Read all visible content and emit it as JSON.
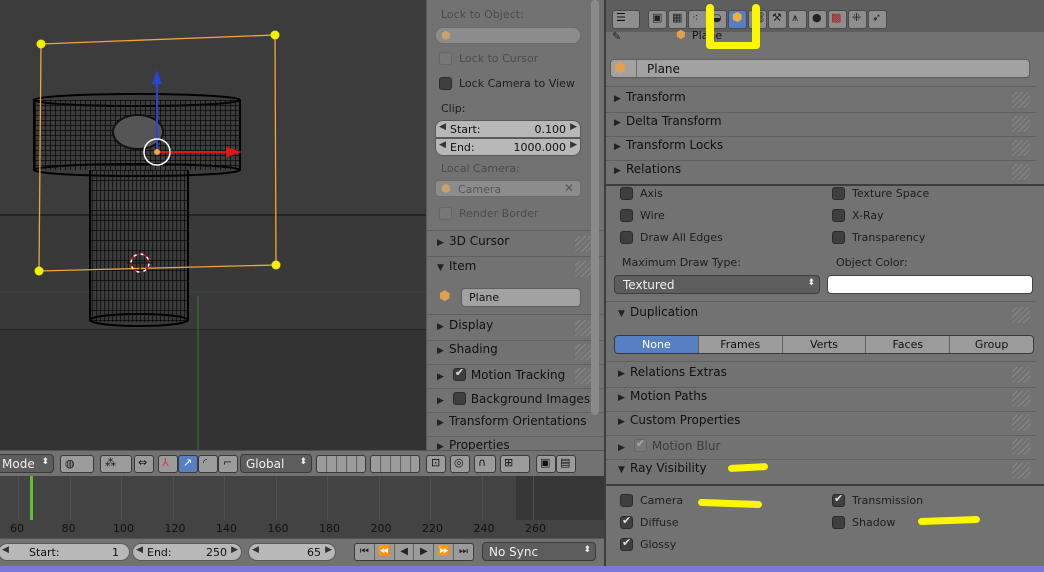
{
  "npanel": {
    "lock_to_object_label": "Lock to Object:",
    "lock_to_cursor": "Lock to Cursor",
    "lock_camera_to_view": "Lock Camera to View",
    "clip_label": "Clip:",
    "clip_start_label": "Start:",
    "clip_start_value": "0.100",
    "clip_end_label": "End:",
    "clip_end_value": "1000.000",
    "local_camera_label": "Local Camera:",
    "local_camera_value": "Camera",
    "render_border": "Render Border",
    "sections": {
      "cursor": "3D Cursor",
      "item": "Item",
      "display": "Display",
      "shading": "Shading",
      "motion_tracking": "Motion Tracking",
      "background_images": "Background Images",
      "transform_orientations": "Transform Orientations",
      "properties": "Properties"
    },
    "item_name": "Plane"
  },
  "header3d": {
    "mode": "Mode",
    "orientation": "Global"
  },
  "timeline": {
    "ticks": [
      "60",
      "80",
      "100",
      "120",
      "140",
      "160",
      "180",
      "200",
      "220",
      "240",
      "260"
    ],
    "start_label": "Start:",
    "start_value": "1",
    "end_label": "End:",
    "end_value": "250",
    "current_frame": "65",
    "sync": "No Sync"
  },
  "props": {
    "breadcrumb": "Plane",
    "object_name": "Plane",
    "sections": {
      "transform": "Transform",
      "delta_transform": "Delta Transform",
      "transform_locks": "Transform Locks",
      "relations": "Relations",
      "duplication": "Duplication",
      "relations_extras": "Relations Extras",
      "motion_paths": "Motion Paths",
      "custom_properties": "Custom Properties",
      "motion_blur": "Motion Blur",
      "ray_visibility": "Ray Visibility"
    },
    "display": {
      "axis": "Axis",
      "texture_space": "Texture Space",
      "wire": "Wire",
      "xray": "X-Ray",
      "draw_all_edges": "Draw All Edges",
      "transparency": "Transparency",
      "max_draw_type_label": "Maximum Draw Type:",
      "max_draw_type_value": "Textured",
      "object_color_label": "Object Color:"
    },
    "duplication_options": [
      "None",
      "Frames",
      "Verts",
      "Faces",
      "Group"
    ],
    "ray_visibility": {
      "camera": "Camera",
      "transmission": "Transmission",
      "diffuse": "Diffuse",
      "shadow": "Shadow",
      "glossy": "Glossy"
    }
  },
  "colors": {
    "accent": "#5680c2",
    "highlight": "#fcf600",
    "selection": "#f3a43b"
  }
}
